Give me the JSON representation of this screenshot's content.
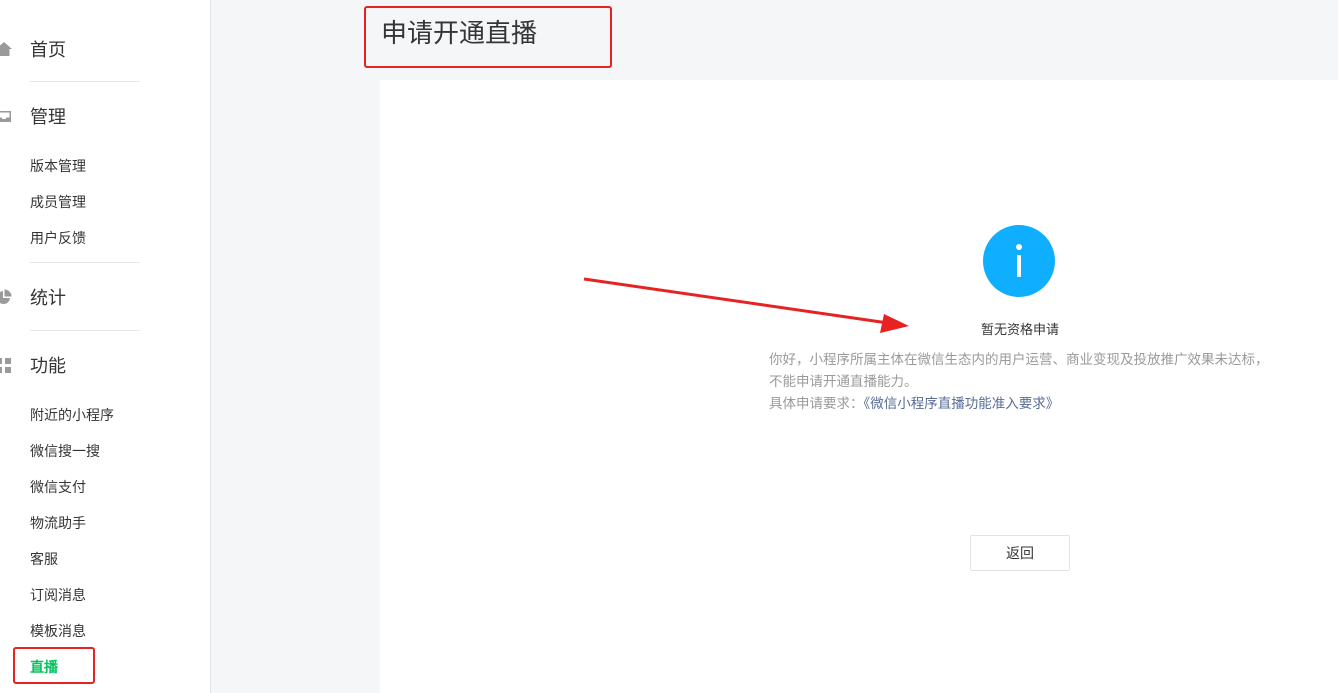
{
  "sidebar": {
    "home": {
      "label": "首页",
      "icon": "home-icon"
    },
    "manage": {
      "label": "管理",
      "icon": "inbox-icon",
      "items": [
        "版本管理",
        "成员管理",
        "用户反馈"
      ]
    },
    "stats": {
      "label": "统计",
      "icon": "pie-chart-icon"
    },
    "features": {
      "label": "功能",
      "icon": "grid-icon",
      "items": [
        "附近的小程序",
        "微信搜一搜",
        "微信支付",
        "物流助手",
        "客服",
        "订阅消息",
        "模板消息",
        "直播"
      ],
      "active": "直播"
    }
  },
  "page": {
    "title": "申请开通直播"
  },
  "message": {
    "icon": "info-icon",
    "title": "暂无资格申请",
    "body": "你好，小程序所属主体在微信生态内的用户运营、商业变现及投放推广效果未达标，不能申请开通直播能力。",
    "link_prefix": "具体申请要求：",
    "link_text": "《微信小程序直播功能准入要求》"
  },
  "actions": {
    "back_label": "返回"
  },
  "colors": {
    "accent_green": "#07c160",
    "info_blue": "#10aeff",
    "link_blue": "#576b95",
    "annotation_red": "#e62222"
  }
}
